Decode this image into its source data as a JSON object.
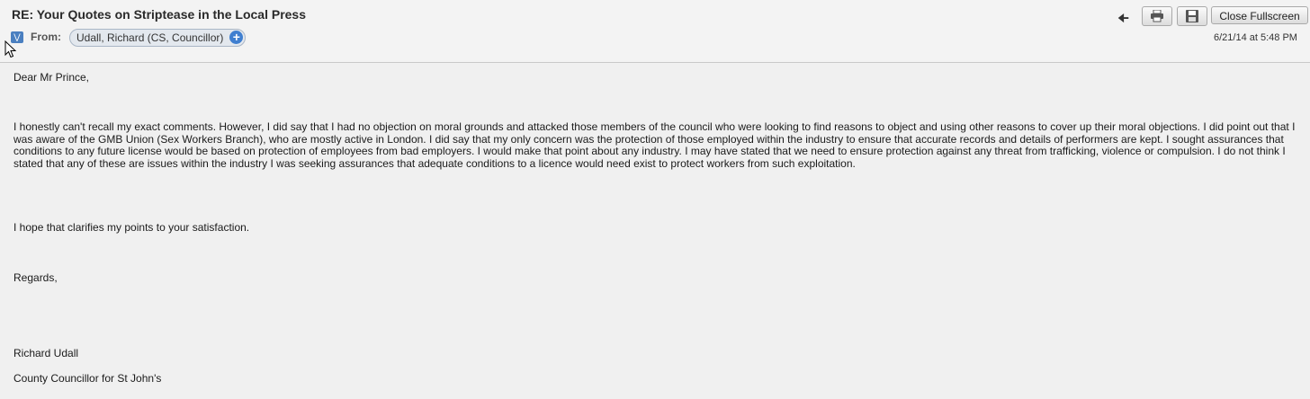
{
  "header": {
    "subject": "RE: Your Quotes on Striptease in the Local Press",
    "from_label": "From:",
    "sender": "Udall, Richard (CS, Councillor)",
    "timestamp": "6/21/14 at 5:48 PM",
    "close_fullscreen_label": "Close Fullscreen",
    "icons": {
      "expand": "chevron-down-icon",
      "add_contact": "plus-icon",
      "back": "back-arrow-icon",
      "print": "printer-icon",
      "save": "save-icon"
    }
  },
  "email_body": {
    "greeting": "Dear Mr Prince,",
    "paragraph_1": "I honestly can't recall my exact comments. However, I did say that I had no objection on moral grounds and attacked those members of the council who were looking to find reasons to object and using other reasons to cover up their moral objections. I did point out that I was aware of the GMB Union (Sex Workers Branch), who are mostly active in London. I did say that my only concern was the protection of those employed within the industry to ensure that accurate records and details of performers are kept. I sought assurances that conditions to any future license would be based on protection of employees from bad employers. I would make that point about any industry. I may have stated that we need to ensure protection against any threat from trafficking, violence or compulsion. I do not think I stated that any of these are issues within the industry I was seeking assurances that adequate conditions to a licence would need exist to protect workers from such exploitation.",
    "paragraph_2": "I hope that clarifies my points to your satisfaction.",
    "signoff": "Regards,",
    "signature_name": "Richard Udall",
    "signature_title": "County Councillor for St John's"
  },
  "colors": {
    "background": "#f0f0f0",
    "chip_background": "#e3e8ee",
    "accent_blue": "#3f7fd0"
  }
}
